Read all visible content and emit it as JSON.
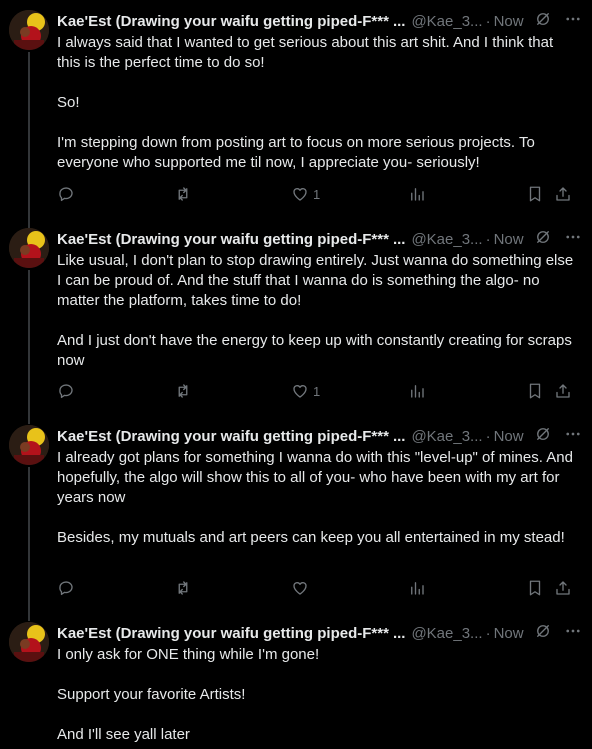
{
  "author": {
    "name": "Kae'Est (Drawing your waifu getting piped-F***",
    "ellipsis": "...",
    "handle_full": "@Kae_3...",
    "handle_short": "@Kae_3...",
    "time": "Now",
    "sep": "·"
  },
  "tweets": [
    {
      "paragraphs": [
        "I always said that I wanted to get serious about this art shit. And I think that this is the perfect time to do so!",
        "So!",
        "I'm stepping down from posting art to focus on more serious projects. To everyone who supported me til now, I appreciate you- seriously!"
      ],
      "likes": "1"
    },
    {
      "paragraphs": [
        "Like usual, I don't plan to stop drawing entirely. Just wanna do something else I can be proud of. And the stuff that I wanna do is something the algo- no matter the platform, takes time to do!",
        "And I just don't have the energy to keep up with constantly creating for scraps now"
      ],
      "likes": "1"
    },
    {
      "paragraphs": [
        "I already got plans for something I wanna do with this \"level-up\" of mines. And hopefully, the algo will show this to all of you- who have been with my art for years now",
        "Besides, my mutuals and art peers can keep you all entertained in my stead!"
      ],
      "likes": ""
    },
    {
      "paragraphs": [
        "I only ask for ONE thing while I'm gone!",
        "Support your favorite Artists!",
        "And I'll see yall later"
      ],
      "likes": ""
    }
  ],
  "icons": [
    "reply-icon",
    "retweet-icon",
    "like-icon",
    "views-icon",
    "bookmark-icon",
    "share-icon",
    "grok-icon",
    "more-icon"
  ]
}
